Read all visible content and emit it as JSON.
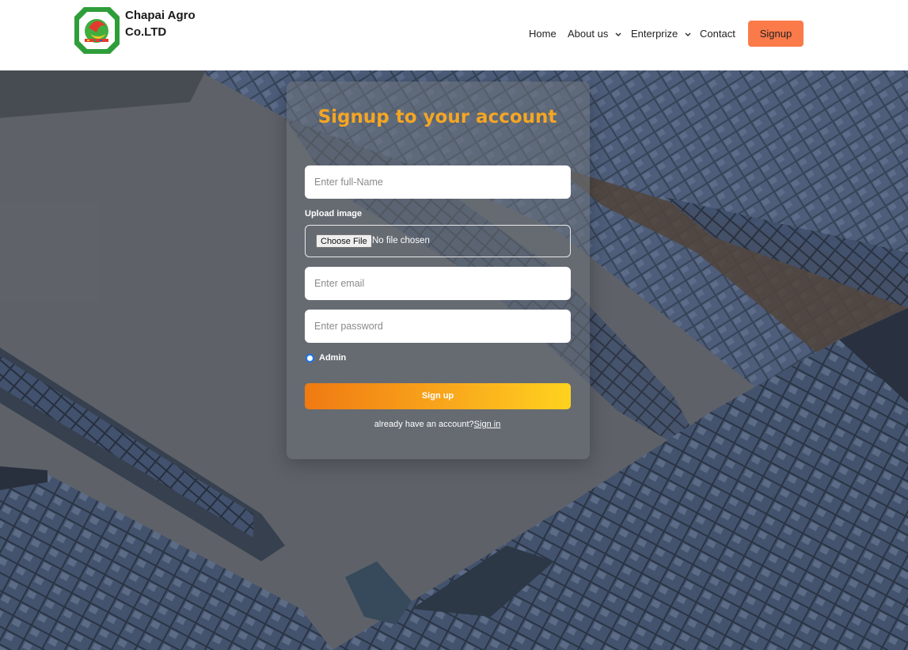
{
  "brand": {
    "line1": "Chapai Agro",
    "line2": "Co.LTD",
    "logo_icon": "chapai-agro-logo"
  },
  "nav": {
    "items": [
      {
        "label": "Home",
        "has_dropdown": false
      },
      {
        "label": "About us",
        "has_dropdown": true
      },
      {
        "label": "Enterprize",
        "has_dropdown": true
      },
      {
        "label": "Contact",
        "has_dropdown": false
      }
    ],
    "signup_label": "Signup",
    "signup_color": "#fb7a4a"
  },
  "form": {
    "title": "Signup to your account",
    "title_color": "#f5a623",
    "fullname_placeholder": "Enter full-Name",
    "upload_label": "Upload image",
    "file_button": "Choose File",
    "file_status": "No file chosen",
    "email_placeholder": "Enter email",
    "password_placeholder": "Enter password",
    "role_option": "Admin",
    "submit_label": "Sign up",
    "already_text": "already have an account?",
    "signin_link": "Sign in"
  }
}
